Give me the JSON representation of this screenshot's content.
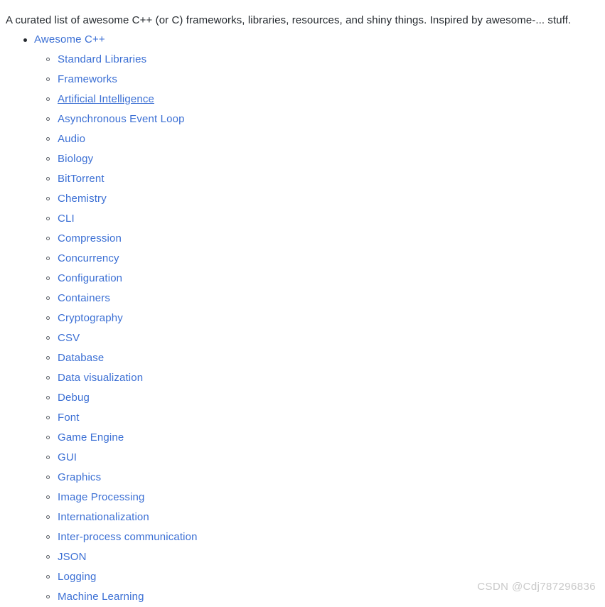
{
  "intro": {
    "text": "A curated list of awesome C++ (or C) frameworks, libraries, resources, and shiny things. Inspired by awesome-... stuff."
  },
  "colors": {
    "link": "#3b6fd4",
    "text": "#24292e",
    "background": "#ffffff",
    "watermark": "#c9c9c9",
    "bullet_outline": "#5a5f66"
  },
  "toc": {
    "root": {
      "label": "Awesome C++",
      "hovered": false
    },
    "items": [
      {
        "label": "Standard Libraries",
        "hovered": false
      },
      {
        "label": "Frameworks",
        "hovered": false
      },
      {
        "label": "Artificial Intelligence",
        "hovered": true
      },
      {
        "label": "Asynchronous Event Loop",
        "hovered": false
      },
      {
        "label": "Audio",
        "hovered": false
      },
      {
        "label": "Biology",
        "hovered": false
      },
      {
        "label": "BitTorrent",
        "hovered": false
      },
      {
        "label": "Chemistry",
        "hovered": false
      },
      {
        "label": "CLI",
        "hovered": false
      },
      {
        "label": "Compression",
        "hovered": false
      },
      {
        "label": "Concurrency",
        "hovered": false
      },
      {
        "label": "Configuration",
        "hovered": false
      },
      {
        "label": "Containers",
        "hovered": false
      },
      {
        "label": "Cryptography",
        "hovered": false
      },
      {
        "label": "CSV",
        "hovered": false
      },
      {
        "label": "Database",
        "hovered": false
      },
      {
        "label": "Data visualization",
        "hovered": false
      },
      {
        "label": "Debug",
        "hovered": false
      },
      {
        "label": "Font",
        "hovered": false
      },
      {
        "label": "Game Engine",
        "hovered": false
      },
      {
        "label": "GUI",
        "hovered": false
      },
      {
        "label": "Graphics",
        "hovered": false
      },
      {
        "label": "Image Processing",
        "hovered": false
      },
      {
        "label": "Internationalization",
        "hovered": false
      },
      {
        "label": "Inter-process communication",
        "hovered": false
      },
      {
        "label": "JSON",
        "hovered": false
      },
      {
        "label": "Logging",
        "hovered": false
      },
      {
        "label": "Machine Learning",
        "hovered": false
      }
    ]
  },
  "watermark": {
    "text": "CSDN @Cdj787296836"
  }
}
